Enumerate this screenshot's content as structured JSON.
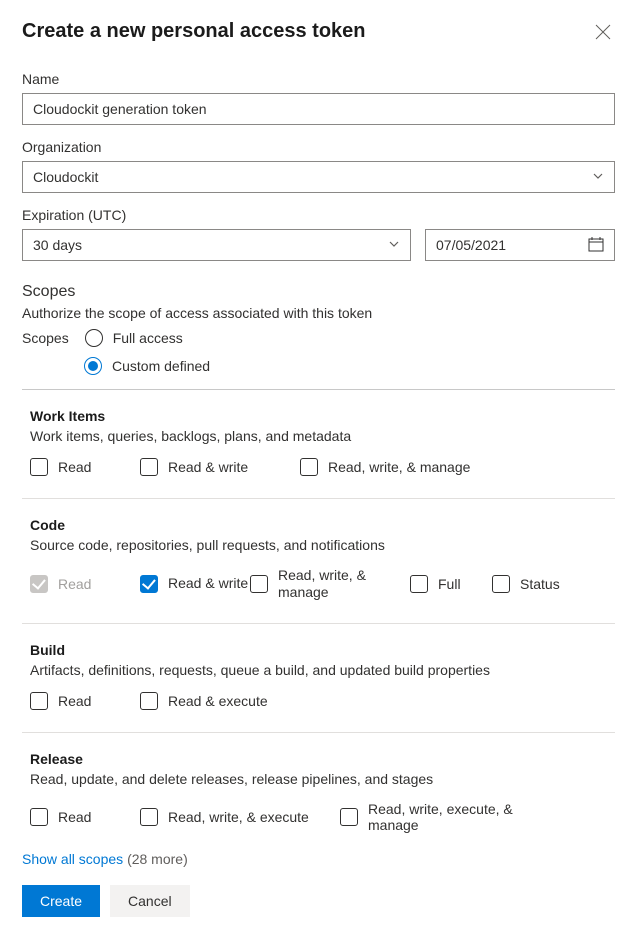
{
  "title": "Create a new personal access token",
  "name_label": "Name",
  "name_value": "Cloudockit generation token",
  "org_label": "Organization",
  "org_value": "Cloudockit",
  "exp_label": "Expiration (UTC)",
  "exp_duration": "30 days",
  "exp_date": "07/05/2021",
  "scopes_title": "Scopes",
  "scopes_subtitle": "Authorize the scope of access associated with this token",
  "scopes_inline_label": "Scopes",
  "radio_full": "Full access",
  "radio_custom": "Custom defined",
  "groups": [
    {
      "name": "Work Items",
      "desc": "Work items, queries, backlogs, plans, and metadata",
      "perms": [
        {
          "label": "Read",
          "checked": false,
          "disabled": false,
          "w": "n"
        },
        {
          "label": "Read & write",
          "checked": false,
          "disabled": false,
          "w": "w"
        },
        {
          "label": "Read, write, & manage",
          "checked": false,
          "disabled": false,
          "w": "xw"
        }
      ]
    },
    {
      "name": "Code",
      "desc": "Source code, repositories, pull requests, and notifications",
      "perms": [
        {
          "label": "Read",
          "checked": true,
          "disabled": true,
          "w": "n"
        },
        {
          "label": "Read & write",
          "checked": true,
          "disabled": false,
          "w": "n",
          "multiline": true
        },
        {
          "label": "Read, write, & manage",
          "checked": false,
          "disabled": false,
          "w": "w",
          "multiline": true
        },
        {
          "label": "Full",
          "checked": false,
          "disabled": false,
          "w": "sn"
        },
        {
          "label": "Status",
          "checked": false,
          "disabled": false,
          "w": "sn"
        }
      ]
    },
    {
      "name": "Build",
      "desc": "Artifacts, definitions, requests, queue a build, and updated build properties",
      "perms": [
        {
          "label": "Read",
          "checked": false,
          "disabled": false,
          "w": "n"
        },
        {
          "label": "Read & execute",
          "checked": false,
          "disabled": false,
          "w": "w"
        }
      ]
    },
    {
      "name": "Release",
      "desc": "Read, update, and delete releases, release pipelines, and stages",
      "perms": [
        {
          "label": "Read",
          "checked": false,
          "disabled": false,
          "w": "n"
        },
        {
          "label": "Read, write, & execute",
          "checked": false,
          "disabled": false,
          "w": "xw"
        },
        {
          "label": "Read, write, execute, & manage",
          "checked": false,
          "disabled": false,
          "w": "xw"
        }
      ]
    }
  ],
  "show_all_label": "Show all scopes",
  "show_all_count": "(28 more)",
  "create_label": "Create",
  "cancel_label": "Cancel"
}
